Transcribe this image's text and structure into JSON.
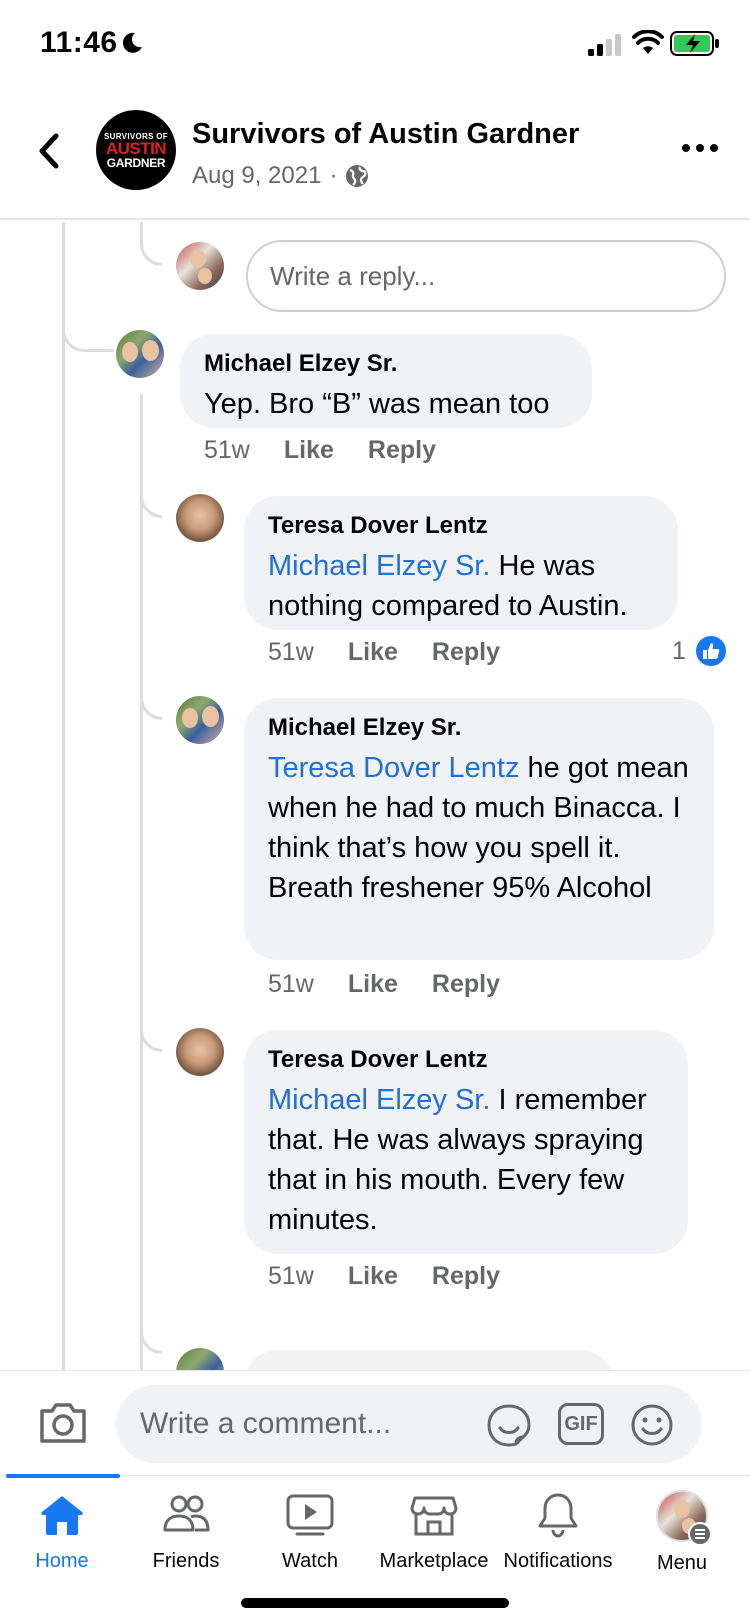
{
  "status_bar": {
    "time": "11:46"
  },
  "header": {
    "group_name": "Survivors of Austin Gardner",
    "date": "Aug 9, 2021",
    "separator": "·",
    "logo": {
      "line1": "SURVIVORS OF",
      "line2": "AUSTIN",
      "line3": "GARDNER"
    }
  },
  "thread": {
    "reply_placeholder": "Write a reply...",
    "comments": [
      {
        "author": "Michael Elzey Sr.",
        "mention": "",
        "text": "Yep. Bro “B” was mean too",
        "time": "51w",
        "like": "Like",
        "reply": "Reply"
      },
      {
        "author": "Teresa Dover Lentz",
        "mention": "Michael Elzey Sr.",
        "text": " He was nothing compared to Austin.",
        "time": "51w",
        "like": "Like",
        "reply": "Reply",
        "likes": "1"
      },
      {
        "author": "Michael Elzey Sr.",
        "mention": "Teresa Dover Lentz",
        "text": "he got mean when he had to much Binacca.  I think that’s how you spell it. Breath freshener 95% Alcohol",
        "time": "51w",
        "like": "Like",
        "reply": "Reply"
      },
      {
        "author": "Teresa Dover Lentz",
        "mention": "Michael Elzey Sr.",
        "text": "I remember that. He was always spraying that in his mouth. Every few minutes.",
        "time": "51w",
        "like": "Like",
        "reply": "Reply"
      }
    ]
  },
  "composer": {
    "placeholder": "Write a comment...",
    "gif_label": "GIF"
  },
  "tabbar": {
    "tabs": [
      {
        "label": "Home",
        "icon": "home-icon",
        "active": true
      },
      {
        "label": "Friends",
        "icon": "friends-icon"
      },
      {
        "label": "Watch",
        "icon": "watch-icon"
      },
      {
        "label": "Marketplace",
        "icon": "marketplace-icon"
      },
      {
        "label": "Notifications",
        "icon": "bell-icon"
      },
      {
        "label": "Menu",
        "icon": "profile-avatar"
      }
    ]
  },
  "colors": {
    "accent": "#1877f2",
    "mention": "#216fdb",
    "bubble": "#f0f2f5"
  }
}
